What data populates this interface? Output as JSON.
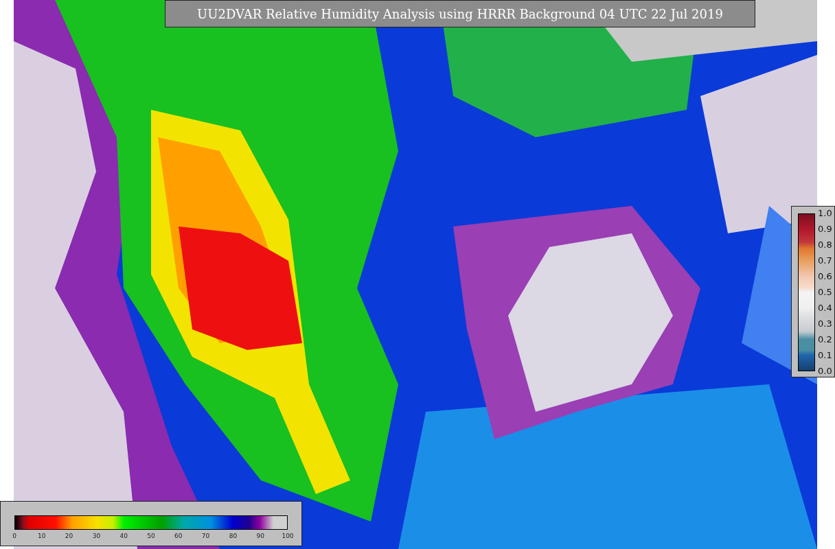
{
  "title": "UU2DVAR Relative Humidity Analysis using HRRR Background 04 UTC 22 Jul 2019",
  "colorbar_vertical": {
    "ticks": [
      "1.0",
      "0.9",
      "0.8",
      "0.7",
      "0.6",
      "0.5",
      "0.4",
      "0.3",
      "0.2",
      "0.1",
      "0.0"
    ]
  },
  "colorbar_horizontal": {
    "ticks": [
      "0",
      "10",
      "20",
      "30",
      "40",
      "50",
      "60",
      "70",
      "80",
      "90",
      "100"
    ]
  }
}
